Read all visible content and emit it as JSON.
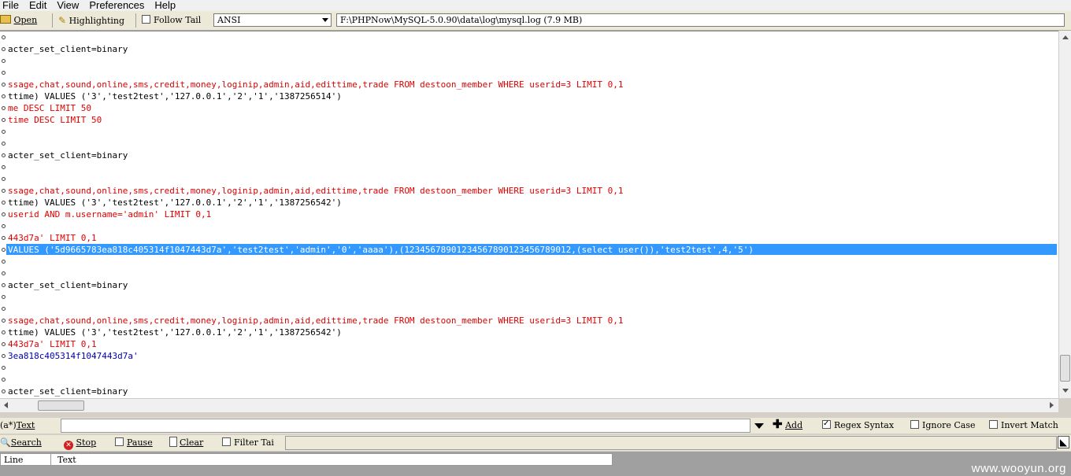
{
  "menu": [
    "File",
    "Edit",
    "View",
    "Preferences",
    "Help"
  ],
  "toolbar": {
    "open_label": "Open",
    "highlighting_label": "Highlighting",
    "follow_tail_label": "Follow Tail",
    "follow_tail_checked": false,
    "encoding_value": "ANSI",
    "file_path": "F:\\PHPNow\\MySQL-5.0.90\\data\\log\\mysql.log (7.9 MB)"
  },
  "log_lines": [
    {
      "text": "",
      "color": "#000000"
    },
    {
      "text": "acter_set_client=binary",
      "color": "#000000"
    },
    {
      "text": "",
      "color": "#000000"
    },
    {
      "text": "",
      "color": "#000000"
    },
    {
      "text": "ssage,chat,sound,online,sms,credit,money,loginip,admin,aid,edittime,trade FROM destoon_member WHERE userid=3 LIMIT 0,1",
      "color": "#e00000"
    },
    {
      "text": "ttime) VALUES ('3','test2test','127.0.0.1','2','1','1387256514')",
      "color": "#000000"
    },
    {
      "text": "me DESC LIMIT 50",
      "color": "#e00000"
    },
    {
      "text": "time DESC LIMIT 50",
      "color": "#e00000"
    },
    {
      "text": "",
      "color": "#000000"
    },
    {
      "text": "",
      "color": "#000000"
    },
    {
      "text": "acter_set_client=binary",
      "color": "#000000"
    },
    {
      "text": "",
      "color": "#000000"
    },
    {
      "text": "",
      "color": "#000000"
    },
    {
      "text": "ssage,chat,sound,online,sms,credit,money,loginip,admin,aid,edittime,trade FROM destoon_member WHERE userid=3 LIMIT 0,1",
      "color": "#e00000"
    },
    {
      "text": "ttime) VALUES ('3','test2test','127.0.0.1','2','1','1387256542')",
      "color": "#000000"
    },
    {
      "text": "userid AND m.username='admin' LIMIT 0,1",
      "color": "#e00000"
    },
    {
      "text": "",
      "color": "#000000"
    },
    {
      "text": "443d7a' LIMIT 0,1",
      "color": "#e00000"
    },
    {
      "text": "VALUES ('5d9665783ea818c405314f1047443d7a','test2test','admin','0','aaaa'),(12345678901234567890123456789012,(select user()),'test2test',4,'5')",
      "color": "#ffffff",
      "selected": true
    },
    {
      "text": "",
      "color": "#000000"
    },
    {
      "text": "",
      "color": "#000000"
    },
    {
      "text": "acter_set_client=binary",
      "color": "#000000"
    },
    {
      "text": "",
      "color": "#000000"
    },
    {
      "text": "",
      "color": "#000000"
    },
    {
      "text": "ssage,chat,sound,online,sms,credit,money,loginip,admin,aid,edittime,trade FROM destoon_member WHERE userid=3 LIMIT 0,1",
      "color": "#e00000"
    },
    {
      "text": "ttime) VALUES ('3','test2test','127.0.0.1','2','1','1387256542')",
      "color": "#000000"
    },
    {
      "text": "443d7a' LIMIT 0,1",
      "color": "#e00000"
    },
    {
      "text": "3ea818c405314f1047443d7a'",
      "color": "#0000b0"
    },
    {
      "text": "",
      "color": "#000000"
    },
    {
      "text": "",
      "color": "#000000"
    },
    {
      "text": "acter_set_client=binary",
      "color": "#000000"
    }
  ],
  "filter": {
    "mode_label": "Text",
    "input_value": "",
    "add_label": "Add",
    "regex_label": "Regex Syntax",
    "regex_checked": true,
    "ignore_case_label": "Ignore Case",
    "ignore_case_checked": false,
    "invert_label": "Invert Match",
    "invert_checked": false
  },
  "controls": {
    "search_label": "Search",
    "stop_label": "Stop",
    "pause_label": "Pause",
    "clear_label": "Clear",
    "filter_tail_label": "Filter Tai"
  },
  "results_table": {
    "columns": [
      "Line",
      "Text"
    ]
  },
  "watermark": "www.wooyun.org",
  "colors": {
    "selection": "#3399ff",
    "sql_red": "#e00000",
    "hash_blue": "#0000b0"
  }
}
